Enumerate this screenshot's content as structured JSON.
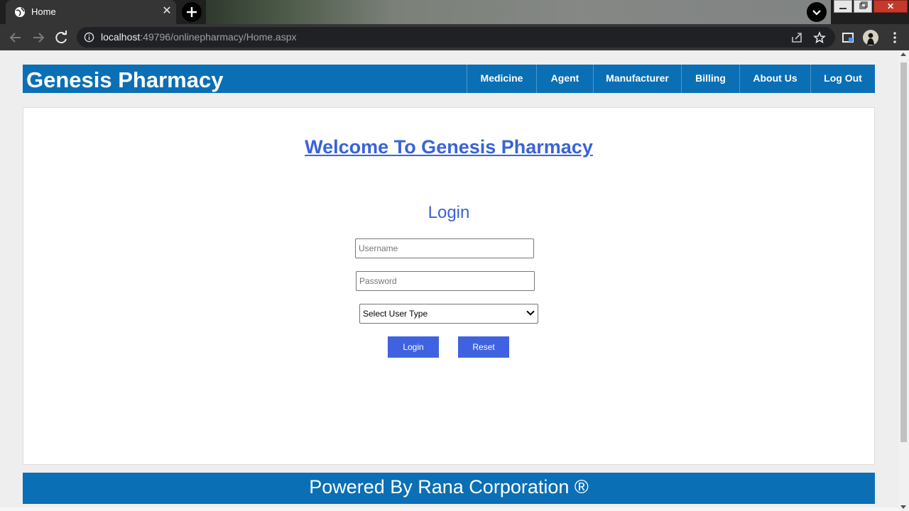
{
  "browser": {
    "tab_title": "Home",
    "tab_close": "✕",
    "url_host": "localhost",
    "url_rest": ":49796/onlinepharmacy/Home.aspx",
    "win_close": "✕"
  },
  "header": {
    "brand": "Genesis Pharmacy",
    "nav": [
      {
        "label": "Medicine"
      },
      {
        "label": "Agent"
      },
      {
        "label": "Manufacturer"
      },
      {
        "label": "Billing"
      },
      {
        "label": "About Us"
      },
      {
        "label": "Log Out"
      }
    ]
  },
  "main": {
    "welcome": "Welcome To Genesis Pharmacy",
    "login_title": "Login",
    "username_placeholder": "Username",
    "password_placeholder": "Password",
    "user_type_selected": "Select User Type",
    "login_button": "Login",
    "reset_button": "Reset"
  },
  "footer": {
    "text": "Powered By Rana Corporation ®"
  },
  "colors": {
    "header_bg": "#0a6fb5",
    "accent": "#3a63d6",
    "button_bg": "#3f63e0"
  }
}
